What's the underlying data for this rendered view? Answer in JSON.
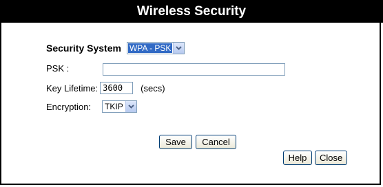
{
  "title": "Wireless Security",
  "security_system": {
    "label": "Security System",
    "selected": "WPA - PSK"
  },
  "psk": {
    "label": "PSK :",
    "value": ""
  },
  "key_lifetime": {
    "label": "Key Lifetime:",
    "value": "3600",
    "unit": "(secs)"
  },
  "encryption": {
    "label": "Encryption:",
    "selected": "TKIP"
  },
  "buttons": {
    "save": "Save",
    "cancel": "Cancel",
    "help": "Help",
    "close": "Close"
  }
}
